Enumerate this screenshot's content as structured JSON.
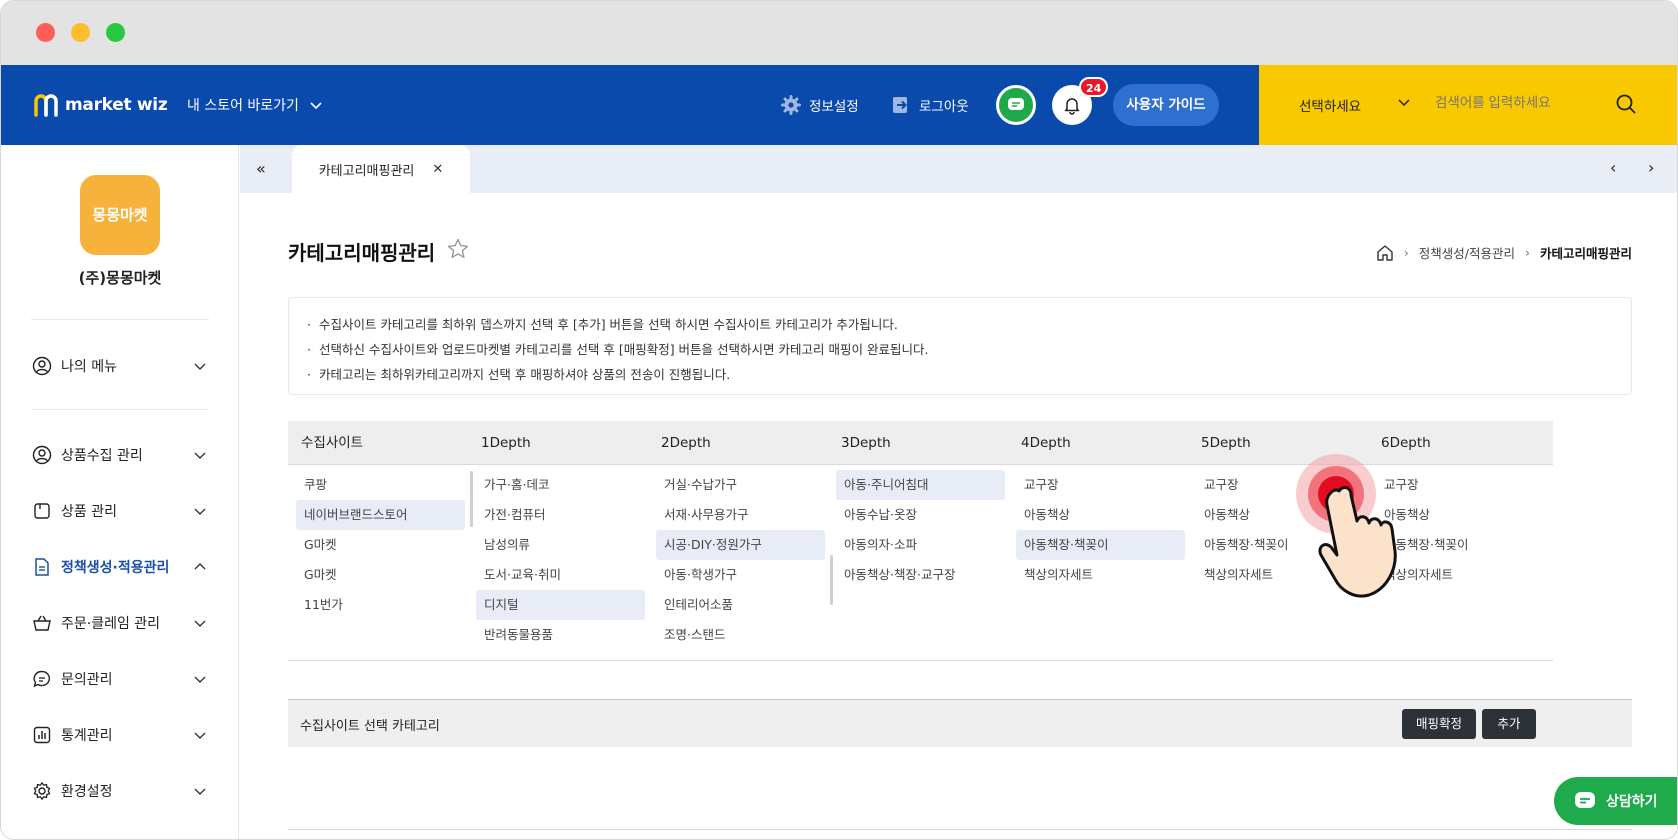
{
  "colors": {
    "nav_blue": "#0a4aad",
    "search_yellow": "#f8c800",
    "badge_red": "#e8192c",
    "chat_green": "#1fab4b",
    "active_menu": "#1c4fa8"
  },
  "header": {
    "logo_text": "market wiz",
    "store_link": "내 스토어 바로가기",
    "settings": "정보설정",
    "logout": "로그아웃",
    "notification_count": "24",
    "guide_button": "사용자 가이드",
    "search_select": "선택하세요",
    "search_placeholder": "검색어를 입력하세요"
  },
  "sidebar": {
    "brand_logo_text": "몽몽마켓",
    "brand_name": "(주)몽몽마켓",
    "my_menu": "나의 메뉴",
    "items": [
      {
        "label": "상품수집 관리",
        "icon": "user-circle-icon"
      },
      {
        "label": "상품 관리",
        "icon": "box-icon"
      },
      {
        "label": "정책생성·적용관리",
        "icon": "document-icon"
      },
      {
        "label": "주문·클레임 관리",
        "icon": "basket-icon"
      },
      {
        "label": "문의관리",
        "icon": "chat-bubble-icon"
      },
      {
        "label": "통계관리",
        "icon": "bar-chart-icon"
      },
      {
        "label": "환경설정",
        "icon": "gear-icon"
      }
    ]
  },
  "tabs": {
    "active_tab": "카테고리매핑관리"
  },
  "main": {
    "title": "카테고리매핑관리",
    "breadcrumb": [
      "정책생성/적용관리",
      "카테고리매핑관리"
    ],
    "notices": [
      "수집사이트 카테고리를 최하위 뎁스까지 선택 후 [추가] 버튼을 선택 하시면 수집사이트 카테고리가 추가됩니다.",
      "선택하신 수집사이트와 업로드마켓별 카테고리를 선택 후 [매핑확정] 버튼을 선택하시면 카테고리 매핑이 완료됩니다.",
      "카테고리는 최하위카테고리까지 선택 후 매핑하셔야 상품의 전송이 진행됩니다."
    ],
    "columns": [
      {
        "header": "수집사이트",
        "items": [
          "쿠팡",
          "네이버브랜드스토어",
          "G마켓",
          "G마켓",
          "11번가"
        ],
        "selected": 1
      },
      {
        "header": "1Depth",
        "items": [
          "가구·홈·데코",
          "가전·컴퓨터",
          "남성의류",
          "도서·교육·취미",
          "디지털",
          "반려동물용품"
        ],
        "selected": 4
      },
      {
        "header": "2Depth",
        "items": [
          "거실·수납가구",
          "서재·사무용가구",
          "시공·DIY·정원가구",
          "아동·학생가구",
          "인테리어소품",
          "조명·스탠드"
        ],
        "selected": 2
      },
      {
        "header": "3Depth",
        "items": [
          "아동·주니어침대",
          "아동수납·옷장",
          "아동의자·소파",
          "아동책상·책장·교구장"
        ],
        "selected": 0
      },
      {
        "header": "4Depth",
        "items": [
          "교구장",
          "아동책상",
          "아동책장·책꽂이",
          "책상의자세트"
        ],
        "selected": 2
      },
      {
        "header": "5Depth",
        "items": [
          "교구장",
          "아동책상",
          "아동책장·책꽂이",
          "책상의자세트"
        ],
        "selected": -1
      },
      {
        "header": "6Depth",
        "items": [
          "교구장",
          "아동책상",
          "아동책장·책꽂이",
          "책상의자세트"
        ],
        "selected": -1
      }
    ],
    "selected_category_title": "수집사이트 선택 카테고리",
    "confirm_button": "매핑확정",
    "add_button": "추가"
  },
  "consult_button": "상담하기"
}
